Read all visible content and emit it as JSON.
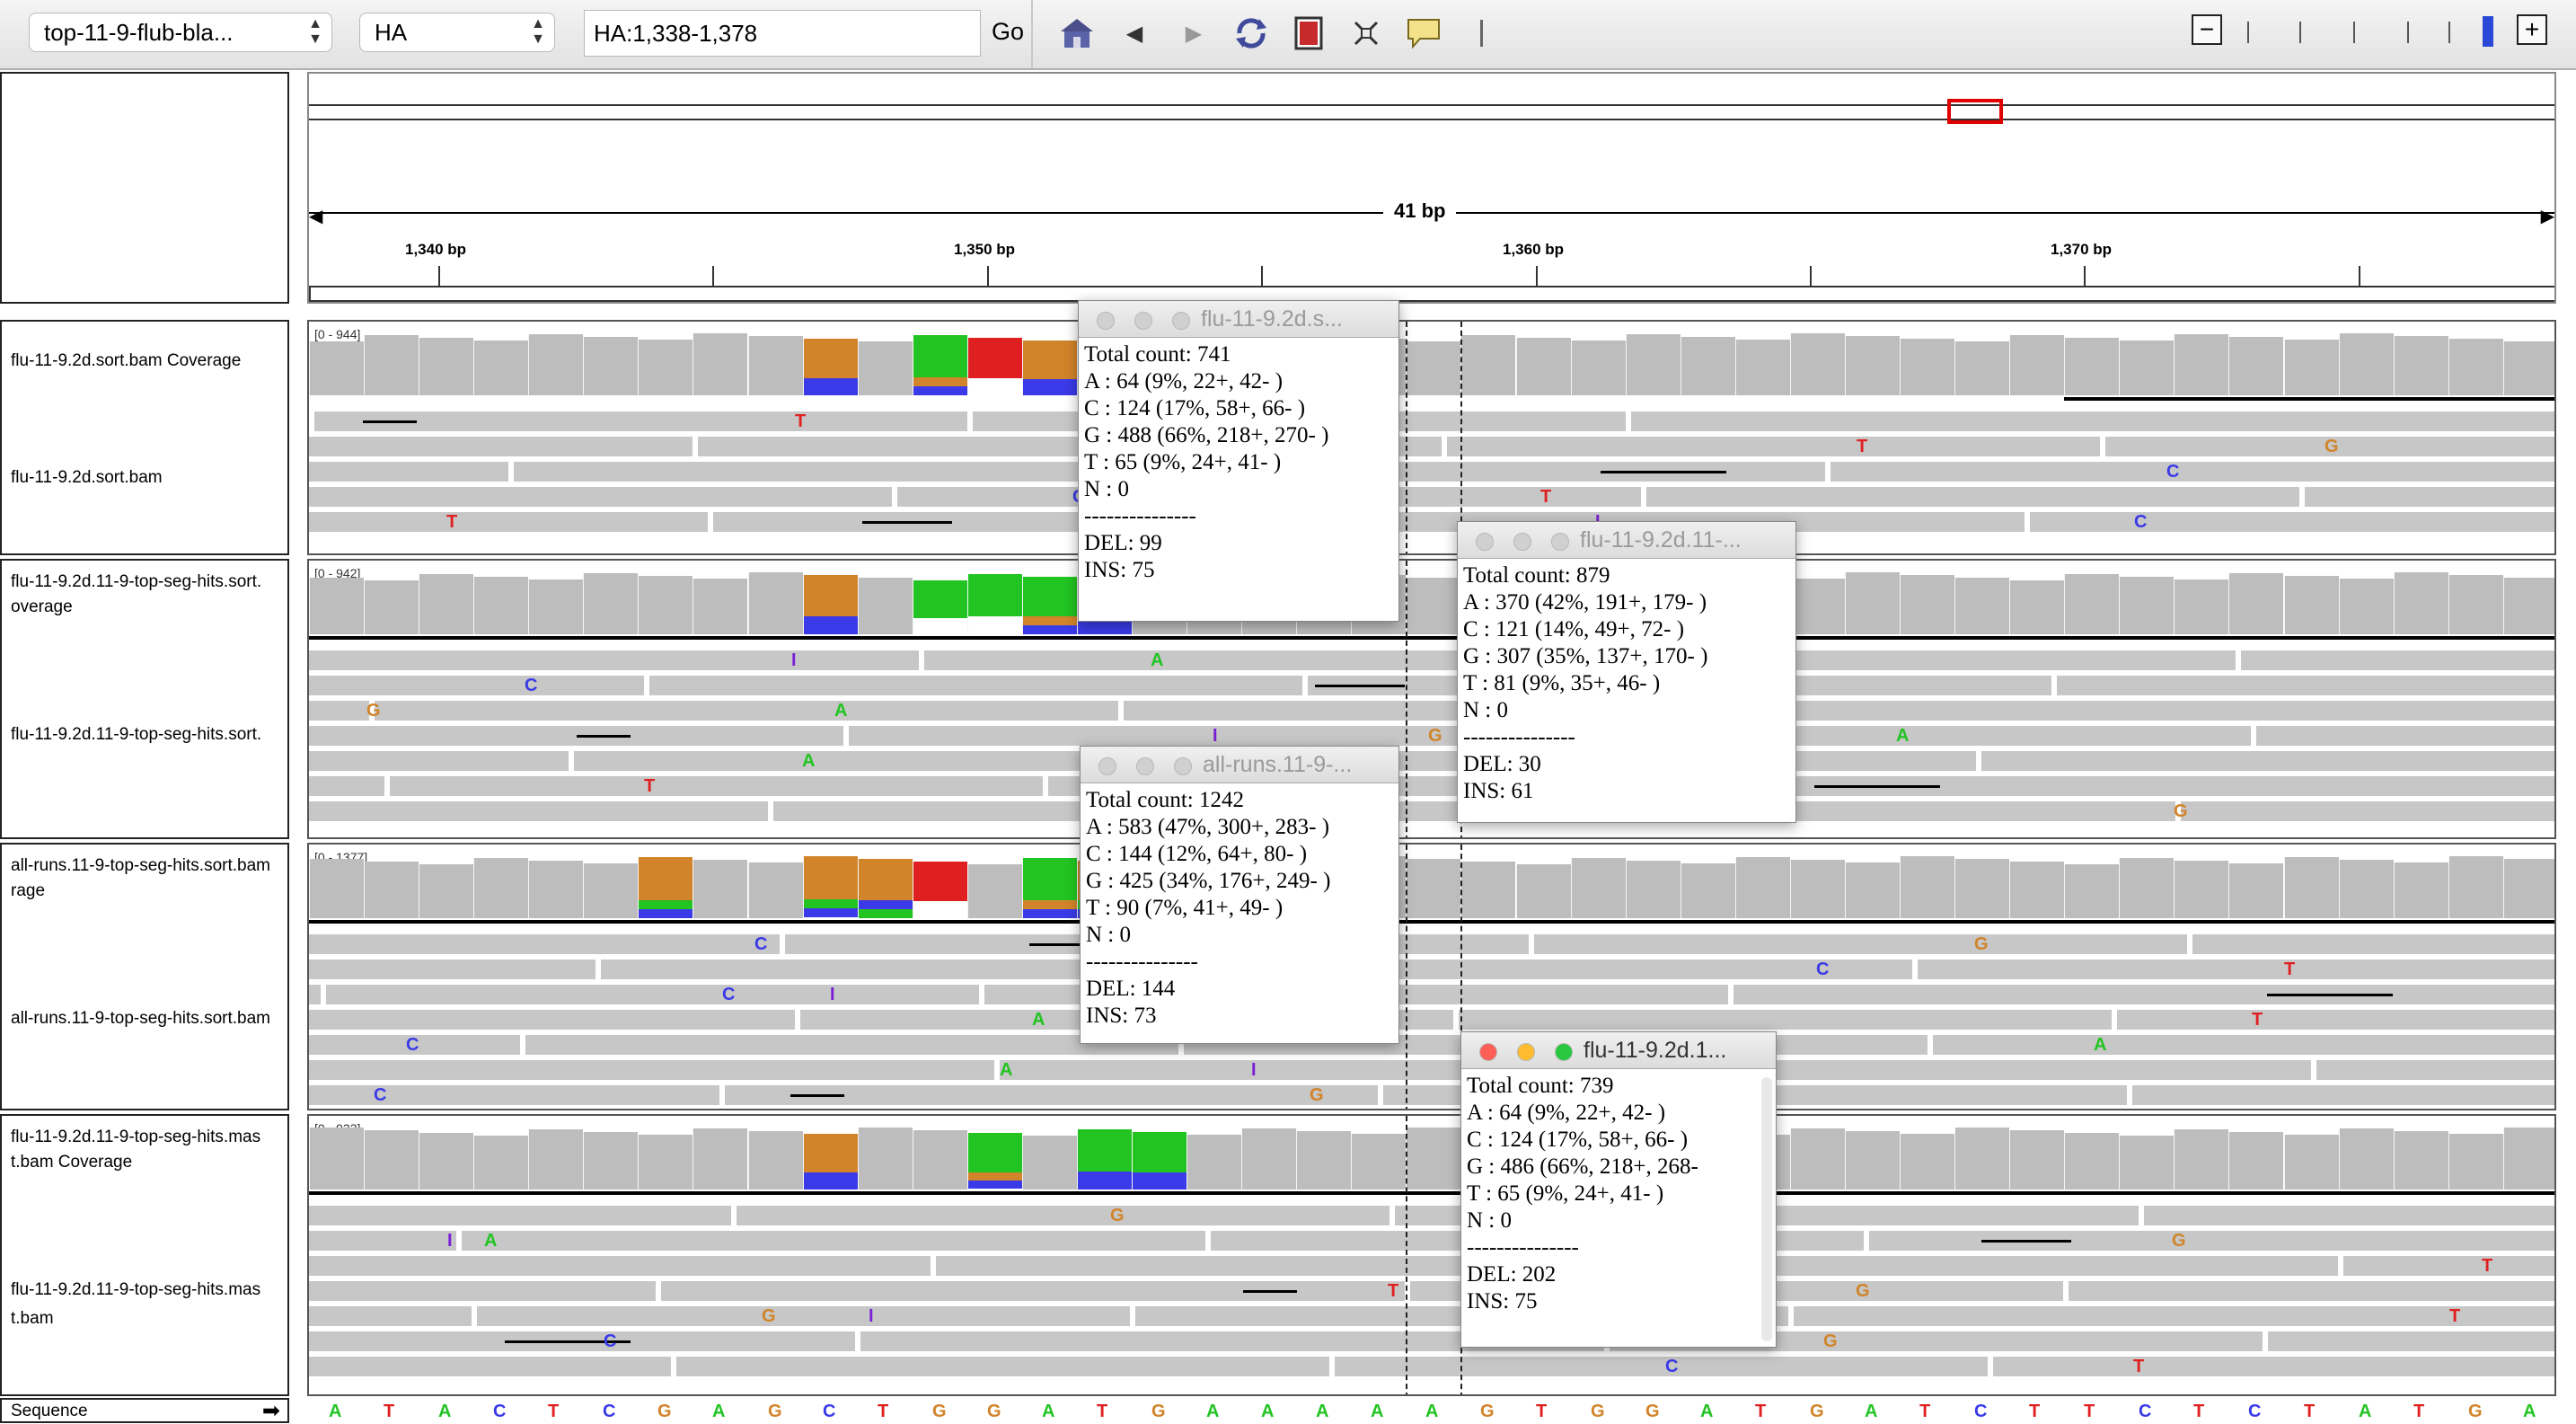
{
  "toolbar": {
    "genome": "top-11-9-flub-bla...",
    "chromosome": "HA",
    "locus": "HA:1,338-1,378",
    "go": "Go"
  },
  "ruler": {
    "span": "41 bp",
    "ticks": [
      "1,340 bp",
      "1,350 bp",
      "1,360 bp",
      "1,370 bp"
    ]
  },
  "tracks": [
    {
      "coverage_label": "flu-11-9.2d.sort.bam Coverage",
      "reads_label": "flu-11-9.2d.sort.bam",
      "range": "[0 - 944]"
    },
    {
      "coverage_label": "flu-11-9.2d.11-9-top-seg-hits.sort.\noverage",
      "reads_label": "flu-11-9.2d.11-9-top-seg-hits.sort.",
      "range": "[0 - 942]"
    },
    {
      "coverage_label": "all-runs.11-9-top-seg-hits.sort.bam\nrage",
      "reads_label": "all-runs.11-9-top-seg-hits.sort.bam",
      "range": "[0 - 1377]"
    },
    {
      "coverage_label": "flu-11-9.2d.11-9-top-seg-hits.mas\nt.bam Coverage",
      "reads_label": "flu-11-9.2d.11-9-top-seg-hits.mas\nt.bam",
      "range": "[0 - 933]"
    }
  ],
  "sequence_label": "Sequence",
  "sequence": [
    "A",
    "T",
    "A",
    "C",
    "T",
    "C",
    "G",
    "A",
    "G",
    "C",
    "T",
    "G",
    "G",
    "A",
    "T",
    "G",
    "A",
    "A",
    "A",
    "A",
    "A",
    "G",
    "T",
    "G",
    "G",
    "A",
    "T",
    "G",
    "A",
    "T",
    "C",
    "T",
    "T",
    "C",
    "T",
    "C",
    "T",
    "A",
    "T",
    "G",
    "A"
  ],
  "popups": [
    {
      "title": "flu-11-9.2d.s...",
      "lines": [
        "Total count: 741",
        "A : 64 (9%, 22+, 42- )",
        "C : 124 (17%, 58+, 66- )",
        "G : 488 (66%, 218+, 270- )",
        "T : 65 (9%, 24+, 41- )",
        "N : 0",
        "---------------",
        "DEL: 99",
        "INS: 75"
      ]
    },
    {
      "title": "flu-11-9.2d.11-...",
      "lines": [
        "Total count: 879",
        "A : 370 (42%, 191+, 179- )",
        "C : 121 (14%, 49+, 72- )",
        "G : 307 (35%, 137+, 170- )",
        "T : 81 (9%, 35+, 46- )",
        "N : 0",
        "---------------",
        "DEL: 30",
        "INS: 61"
      ]
    },
    {
      "title": "all-runs.11-9-...",
      "lines": [
        "Total count: 1242",
        "A : 583 (47%, 300+, 283- )",
        "C : 144 (12%, 64+, 80- )",
        "G : 425 (34%, 176+, 249- )",
        "T : 90 (7%, 41+, 49- )",
        "N : 0",
        "---------------",
        "DEL: 144",
        "INS: 73"
      ]
    },
    {
      "title": "flu-11-9.2d.1...",
      "lines": [
        "Total count: 739",
        "A : 64 (9%, 22+, 42- )",
        "C : 124 (17%, 58+, 66- )",
        "G : 486 (66%, 218+, 268-",
        "T : 65 (9%, 24+, 41- )",
        "N : 0",
        "---------------",
        "DEL: 202",
        "INS: 75"
      ]
    }
  ],
  "base_colors": {
    "A": "#22c422",
    "C": "#3a3ae8",
    "G": "#d1842a",
    "T": "#e02020"
  },
  "ins_color": "#7a1fd6"
}
